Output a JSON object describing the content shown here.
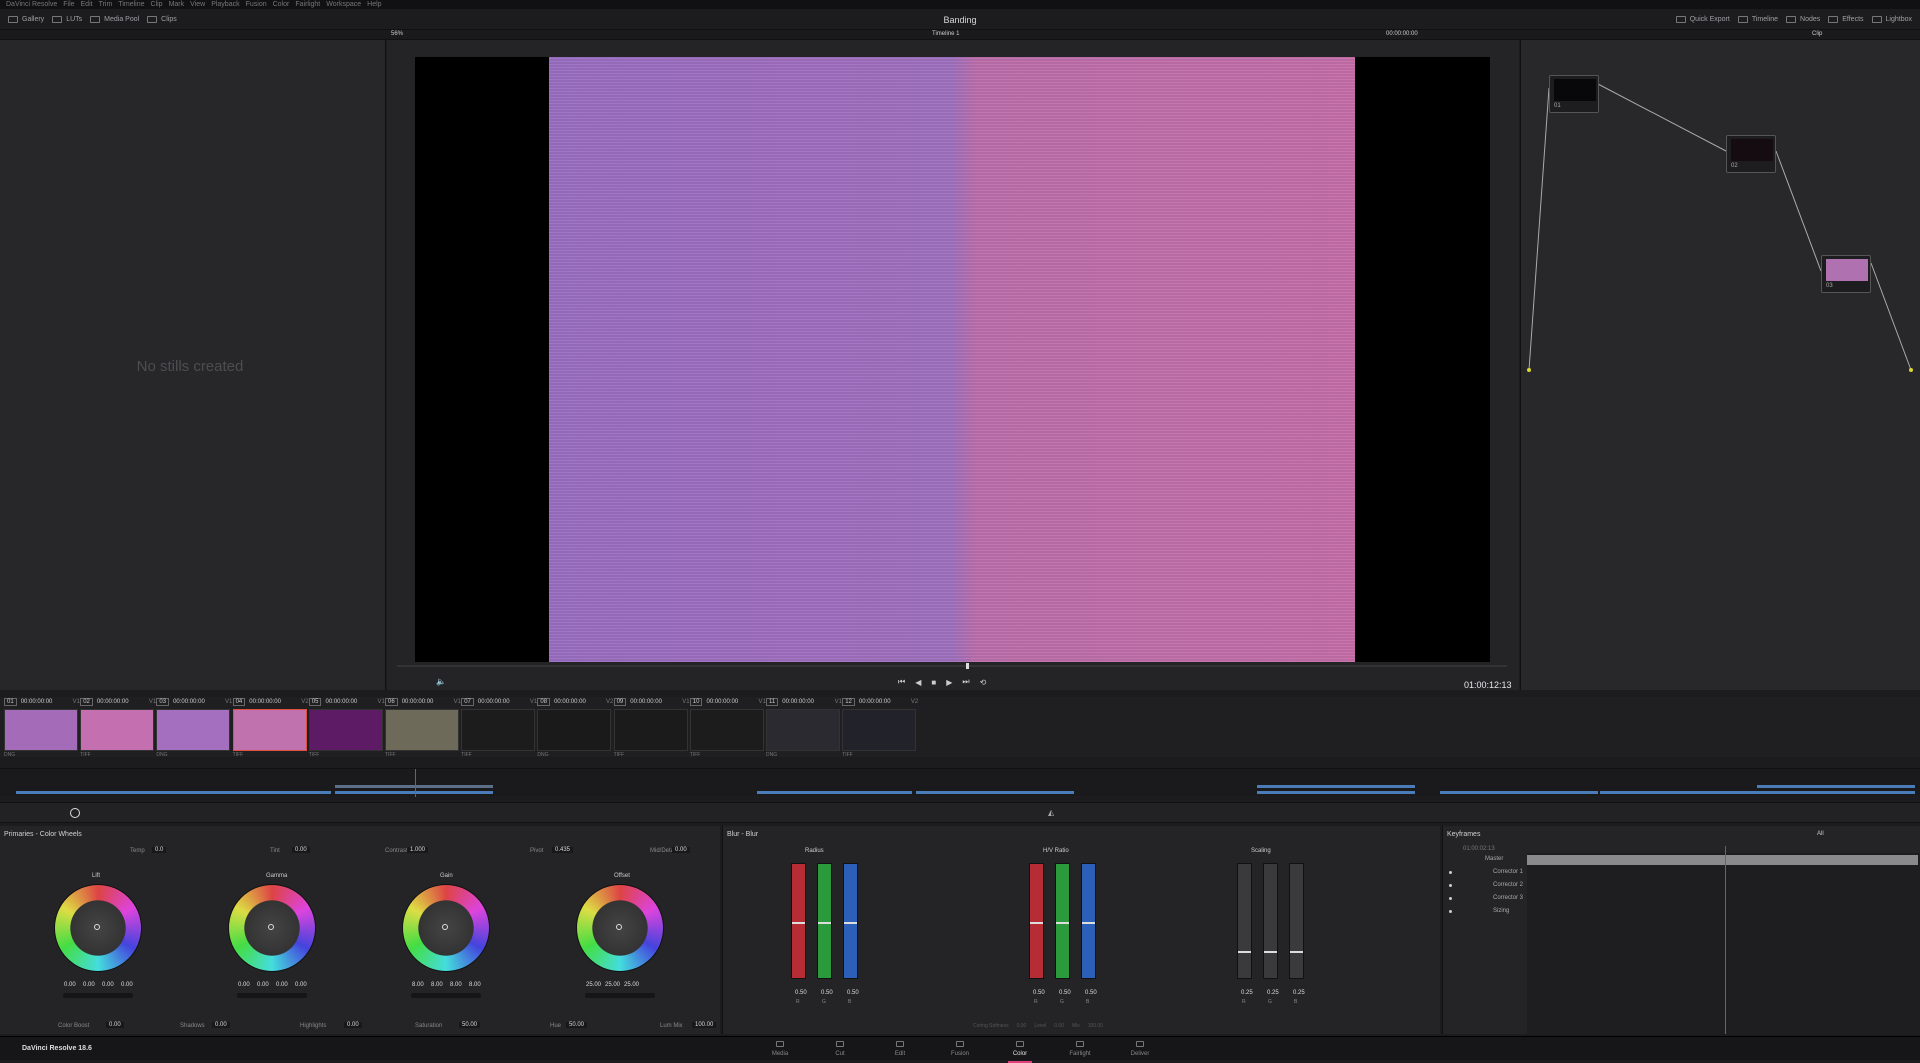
{
  "menu": [
    "DaVinci Resolve",
    "File",
    "Edit",
    "Trim",
    "Timeline",
    "Clip",
    "Mark",
    "View",
    "Playback",
    "Fusion",
    "Color",
    "Fairlight",
    "Workspace",
    "Help"
  ],
  "toolbar": {
    "left": [
      "Gallery",
      "LUTs",
      "Media Pool",
      "Clips"
    ],
    "right": [
      "Quick Export",
      "Timeline",
      "Nodes",
      "Effects",
      "Lightbox"
    ]
  },
  "project_title": "Banding",
  "viewer": {
    "zoom": "56%",
    "timeline_name": "Timeline 1",
    "timecode_top": "00:00:00:00",
    "timecode": "01:00:12:13",
    "clip_mode": "Clip"
  },
  "gallery": {
    "empty_text": "No stills created"
  },
  "nodes": [
    "01",
    "02",
    "03"
  ],
  "clips": [
    {
      "num": "01",
      "tc": "00:00:00:00",
      "track": "V1",
      "codec": "DNG",
      "color": "#a46bb8"
    },
    {
      "num": "02",
      "tc": "00:00:00:00",
      "track": "V1",
      "codec": "TIFF",
      "color": "#c46fb0"
    },
    {
      "num": "03",
      "tc": "00:00:00:00",
      "track": "V1",
      "codec": "DNG",
      "color": "#a56fbf"
    },
    {
      "num": "04",
      "tc": "00:00:00:00",
      "track": "V2",
      "codec": "TIFF",
      "color": "#bf72ae"
    },
    {
      "num": "05",
      "tc": "00:00:00:00",
      "track": "V1",
      "codec": "TIFF",
      "color": "#5d1b66"
    },
    {
      "num": "06",
      "tc": "00:00:00:00",
      "track": "V1",
      "codec": "TIFF",
      "color": "#6e6a5a"
    },
    {
      "num": "07",
      "tc": "00:00:00:00",
      "track": "V1",
      "codec": "TIFF",
      "color": "#1c1c1c"
    },
    {
      "num": "08",
      "tc": "00:00:00:00",
      "track": "V2",
      "codec": "DNG",
      "color": "#1a1a1a"
    },
    {
      "num": "09",
      "tc": "00:00:00:00",
      "track": "V1",
      "codec": "TIFF",
      "color": "#1b1b1b"
    },
    {
      "num": "10",
      "tc": "00:00:00:00",
      "track": "V1",
      "codec": "TIFF",
      "color": "#1c1c1c"
    },
    {
      "num": "11",
      "tc": "00:00:00:00",
      "track": "V1",
      "codec": "DNG",
      "color": "#2a2a30"
    },
    {
      "num": "12",
      "tc": "00:00:00:00",
      "track": "V2",
      "codec": "TIFF",
      "color": "#22222a"
    }
  ],
  "primaries": {
    "title": "Primaries - Color Wheels",
    "top": [
      {
        "label": "Temp",
        "value": "0.0"
      },
      {
        "label": "Tint",
        "value": "0.00"
      },
      {
        "label": "Contrast",
        "value": "1.000"
      },
      {
        "label": "Pivot",
        "value": "0.435"
      },
      {
        "label": "Mid/Detail",
        "value": "0.00"
      }
    ],
    "wheels": [
      {
        "label": "Lift",
        "values": [
          "0.00",
          "0.00",
          "0.00",
          "0.00"
        ]
      },
      {
        "label": "Gamma",
        "values": [
          "0.00",
          "0.00",
          "0.00",
          "0.00"
        ]
      },
      {
        "label": "Gain",
        "values": [
          "8.00",
          "8.00",
          "8.00",
          "8.00"
        ]
      },
      {
        "label": "Offset",
        "values": [
          "25.00",
          "25.00",
          "25.00"
        ]
      }
    ],
    "bottom": [
      {
        "label": "Color Boost",
        "value": "0.00"
      },
      {
        "label": "Shadows",
        "value": "0.00"
      },
      {
        "label": "Highlights",
        "value": "0.00"
      },
      {
        "label": "Saturation",
        "value": "50.00"
      },
      {
        "label": "Hue",
        "value": "50.00"
      },
      {
        "label": "Lum Mix",
        "value": "100.00"
      }
    ]
  },
  "blur": {
    "title": "Blur - Blur",
    "groups": [
      {
        "label": "Radius",
        "values": [
          "0.50",
          "0.50",
          "0.50"
        ],
        "level": 0.5
      },
      {
        "label": "H/V Ratio",
        "values": [
          "0.50",
          "0.50",
          "0.50"
        ],
        "level": 0.5
      },
      {
        "label": "Scaling",
        "values": [
          "0.25",
          "0.25",
          "0.25"
        ],
        "level": 0.25
      }
    ],
    "channels": [
      "R",
      "G",
      "B"
    ],
    "footer": [
      "Coring Softness",
      "0.00",
      "Level",
      "0.00",
      "Mix",
      "100.00"
    ]
  },
  "keyframes": {
    "title": "Keyframes",
    "filter": "All",
    "timecode": "01:00:02:13",
    "rows": [
      "Master",
      "Corrector 1",
      "Corrector 2",
      "Corrector 3",
      "Sizing"
    ]
  },
  "app_name": "DaVinci Resolve 18.6",
  "pages": [
    "Media",
    "Cut",
    "Edit",
    "Fusion",
    "Color",
    "Fairlight",
    "Deliver"
  ],
  "active_page": "Color"
}
